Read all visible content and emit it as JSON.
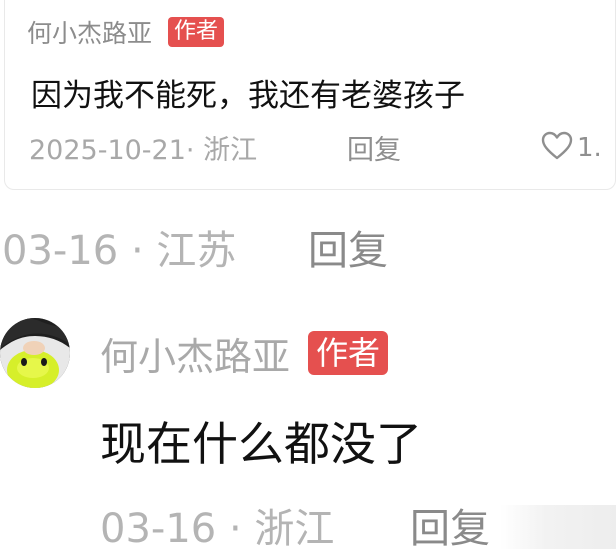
{
  "quoted_comment": {
    "author": "何小杰路亚",
    "badge": "作者",
    "text": "因为我不能死，我还有老婆孩子",
    "meta": "2025-10-21· 浙江",
    "reply_label": "回复",
    "like_count": "1.",
    "like_icon": "heart-outline-icon"
  },
  "comment_1": {
    "meta": "03-16 · 江苏",
    "reply_label": "回复"
  },
  "comment_2": {
    "author": "何小杰路亚",
    "badge": "作者",
    "text": "现在什么都没了",
    "meta": "03-16 · 浙江",
    "reply_label": "回复",
    "avatar_icon": "user-avatar"
  },
  "colors": {
    "badge": "#e5504f",
    "meta_text": "#b4b4b4",
    "body_text": "#111111"
  }
}
